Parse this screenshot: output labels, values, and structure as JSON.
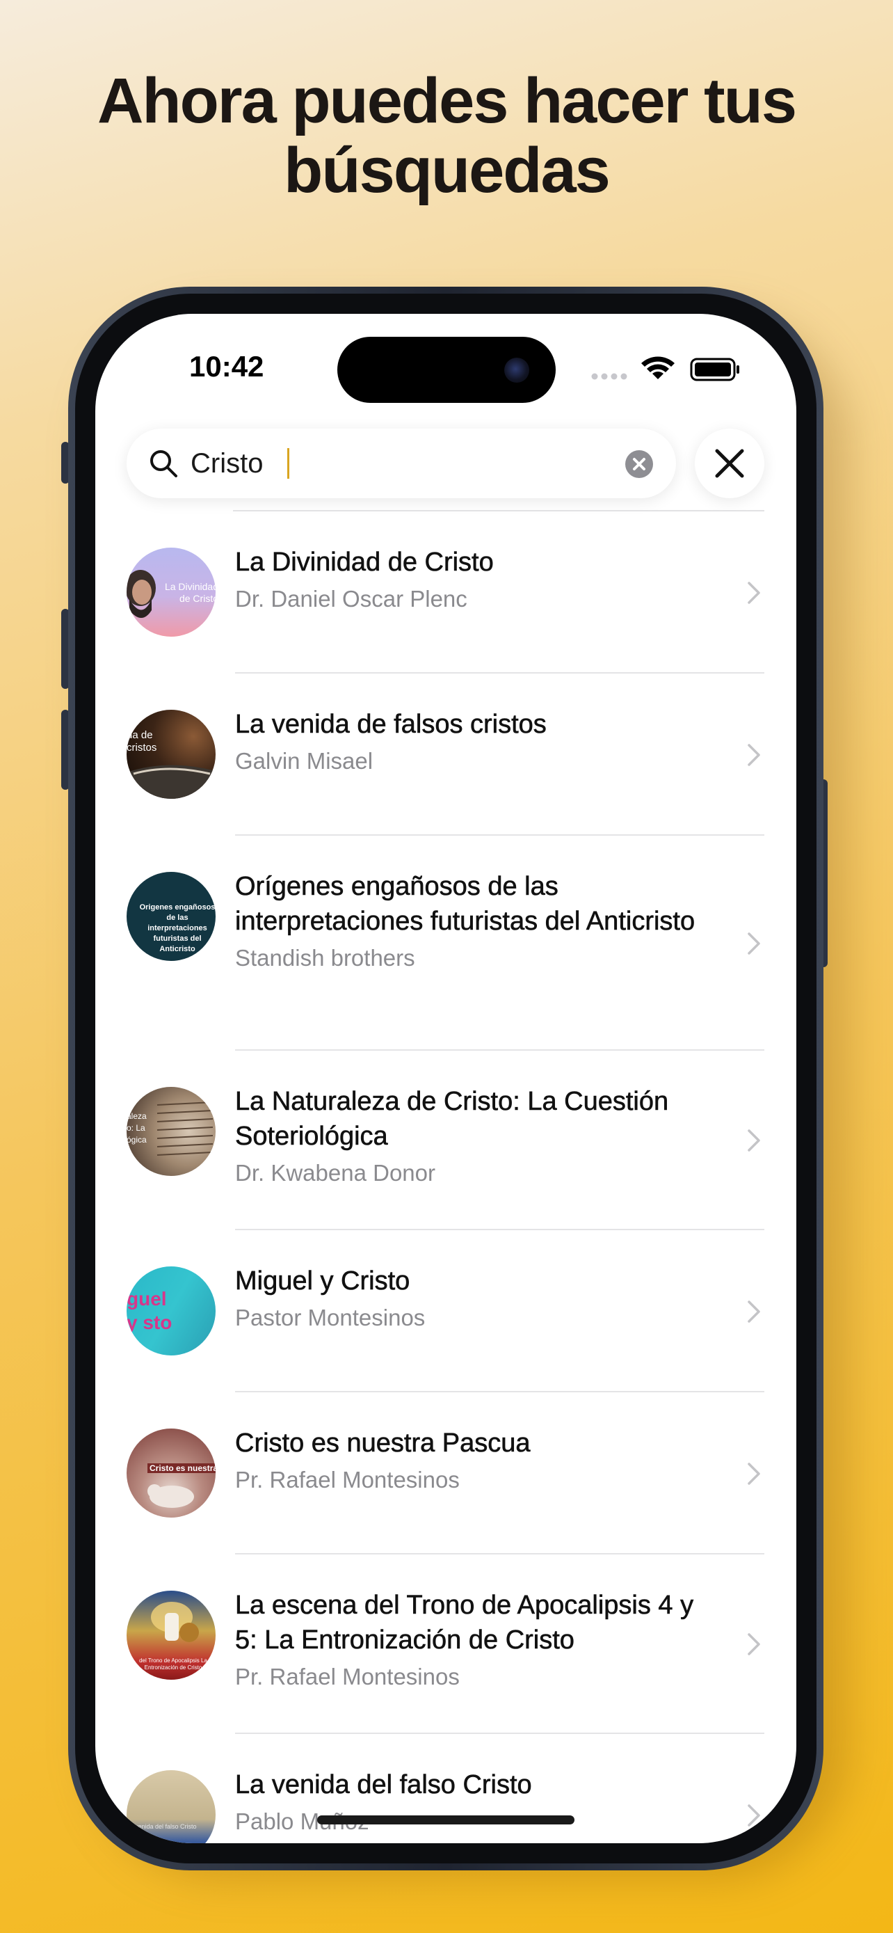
{
  "headline": {
    "line1": "Ahora puedes hacer tus",
    "line2": "búsquedas"
  },
  "status_bar": {
    "time": "10:42"
  },
  "search": {
    "value": "Cristo"
  },
  "results": [
    {
      "title": "La Divinidad de Cristo",
      "subtitle": "Dr. Daniel Oscar Plenc",
      "thumb_text": "La Divinidad de Cristo"
    },
    {
      "title": "La venida de falsos cristos",
      "subtitle": "Galvin Misael",
      "thumb_text": "da de cristos"
    },
    {
      "title": "Orígenes engañosos de las interpretaciones futuristas del Anticristo",
      "subtitle": "Standish brothers",
      "thumb_text": "Origenes engañosos de las interpretaciones futuristas del Anticristo"
    },
    {
      "title": "La Naturaleza de Cristo: La Cuestión Soteriológica",
      "subtitle": "Dr. Kwabena Donor",
      "thumb_text": "aleza o: La ógica"
    },
    {
      "title": "Miguel y Cristo",
      "subtitle": "Pastor Montesinos",
      "thumb_text": "guel y sto"
    },
    {
      "title": "Cristo es nuestra Pascua",
      "subtitle": "Pr. Rafael Montesinos",
      "thumb_text": "Cristo es nuestra"
    },
    {
      "title": "La escena del Trono de Apocalipsis 4 y 5: La Entronización de Cristo",
      "subtitle": "Pr. Rafael Montesinos",
      "thumb_text": "del Trono de Apocalipsis La Entronización de Cristo"
    },
    {
      "title": "La venida del falso Cristo",
      "subtitle": "Pablo Muñoz",
      "thumb_text": "venida del falso Cristo"
    }
  ],
  "colors": {
    "accent_caret": "#d9a521",
    "background_top": "#f6ecdc",
    "background_bottom": "#f3b716"
  }
}
